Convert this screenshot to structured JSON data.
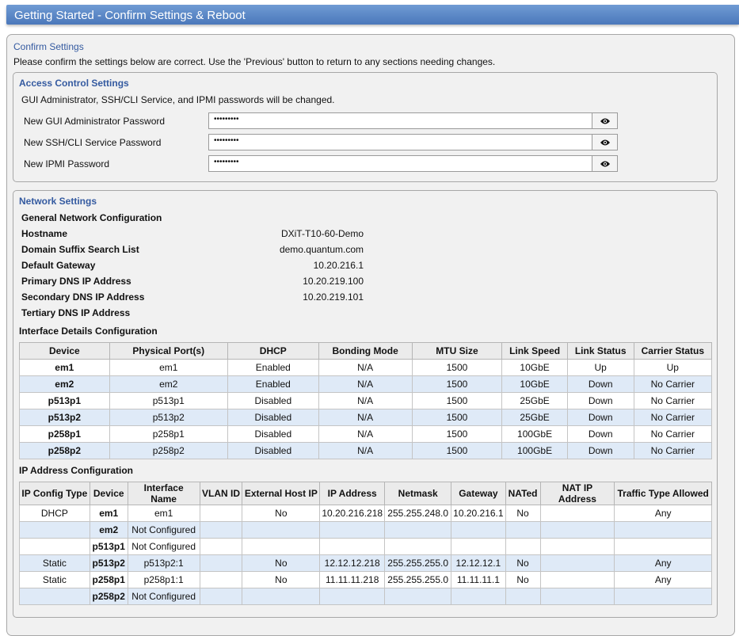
{
  "title": "Getting Started - Confirm Settings & Reboot",
  "confirm": {
    "heading": "Confirm Settings",
    "instruction": "Please confirm the settings below are correct. Use the 'Previous' button to return to any sections needing changes."
  },
  "access_control": {
    "heading": "Access Control Settings",
    "note": "GUI Administrator, SSH/CLI Service, and IPMI passwords will be changed.",
    "fields": [
      {
        "label": "New GUI Administrator Password",
        "value": "•••••••••"
      },
      {
        "label": "New SSH/CLI Service Password",
        "value": "•••••••••"
      },
      {
        "label": "New IPMI Password",
        "value": "•••••••••"
      }
    ],
    "reveal_icon": "eye-icon"
  },
  "network": {
    "heading": "Network Settings",
    "general_heading": "General Network Configuration",
    "general": [
      {
        "label": "Hostname",
        "value": "DXiT-T10-60-Demo"
      },
      {
        "label": "Domain Suffix Search List",
        "value": "demo.quantum.com"
      },
      {
        "label": "Default Gateway",
        "value": "10.20.216.1"
      },
      {
        "label": "Primary DNS IP Address",
        "value": "10.20.219.100"
      },
      {
        "label": "Secondary DNS IP Address",
        "value": "10.20.219.101"
      },
      {
        "label": "Tertiary DNS IP Address",
        "value": ""
      }
    ],
    "interface_heading": "Interface Details Configuration",
    "interface_columns": [
      "Device",
      "Physical Port(s)",
      "DHCP",
      "Bonding Mode",
      "MTU Size",
      "Link Speed",
      "Link Status",
      "Carrier Status"
    ],
    "interface_rows": [
      [
        "em1",
        "em1",
        "Enabled",
        "N/A",
        "1500",
        "10GbE",
        "Up",
        "Up"
      ],
      [
        "em2",
        "em2",
        "Enabled",
        "N/A",
        "1500",
        "10GbE",
        "Down",
        "No Carrier"
      ],
      [
        "p513p1",
        "p513p1",
        "Disabled",
        "N/A",
        "1500",
        "25GbE",
        "Down",
        "No Carrier"
      ],
      [
        "p513p2",
        "p513p2",
        "Disabled",
        "N/A",
        "1500",
        "25GbE",
        "Down",
        "No Carrier"
      ],
      [
        "p258p1",
        "p258p1",
        "Disabled",
        "N/A",
        "1500",
        "100GbE",
        "Down",
        "No Carrier"
      ],
      [
        "p258p2",
        "p258p2",
        "Disabled",
        "N/A",
        "1500",
        "100GbE",
        "Down",
        "No Carrier"
      ]
    ],
    "ip_heading": "IP Address Configuration",
    "ip_columns": [
      "IP Config Type",
      "Device",
      "Interface Name",
      "VLAN ID",
      "External Host IP",
      "IP Address",
      "Netmask",
      "Gateway",
      "NATed",
      "NAT IP Address",
      "Traffic Type Allowed"
    ],
    "ip_rows": [
      [
        "DHCP",
        "em1",
        "em1",
        "",
        "No",
        "10.20.216.218",
        "255.255.248.0",
        "10.20.216.1",
        "No",
        "",
        "Any"
      ],
      [
        "",
        "em2",
        "Not Configured",
        "",
        "",
        "",
        "",
        "",
        "",
        "",
        ""
      ],
      [
        "",
        "p513p1",
        "Not Configured",
        "",
        "",
        "",
        "",
        "",
        "",
        "",
        ""
      ],
      [
        "Static",
        "p513p2",
        "p513p2:1",
        "",
        "No",
        "12.12.12.218",
        "255.255.255.0",
        "12.12.12.1",
        "No",
        "",
        "Any"
      ],
      [
        "Static",
        "p258p1",
        "p258p1:1",
        "",
        "No",
        "11.11.11.218",
        "255.255.255.0",
        "11.11.11.1",
        "No",
        "",
        "Any"
      ],
      [
        "",
        "p258p2",
        "Not Configured",
        "",
        "",
        "",
        "",
        "",
        "",
        "",
        ""
      ]
    ]
  }
}
